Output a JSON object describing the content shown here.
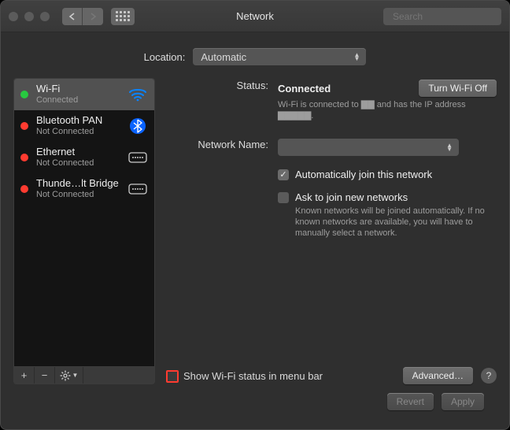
{
  "window": {
    "title": "Network"
  },
  "search": {
    "placeholder": "Search"
  },
  "location": {
    "label": "Location:",
    "value": "Automatic"
  },
  "services": [
    {
      "name": "Wi-Fi",
      "status": "Connected",
      "dot": "green",
      "icon": "wifi"
    },
    {
      "name": "Bluetooth PAN",
      "status": "Not Connected",
      "dot": "red",
      "icon": "bluetooth"
    },
    {
      "name": "Ethernet",
      "status": "Not Connected",
      "dot": "red",
      "icon": "ethernet"
    },
    {
      "name": "Thunde…lt Bridge",
      "status": "Not Connected",
      "dot": "red",
      "icon": "ethernet"
    }
  ],
  "detail": {
    "status_label": "Status:",
    "status_value": "Connected",
    "toggle_label": "Turn Wi-Fi Off",
    "status_sub": "Wi-Fi is connected to ▇▇ and has the IP address ▇▇▇▇▇.",
    "netname_label": "Network Name:",
    "netname_value": "",
    "auto_join": "Automatically join this network",
    "ask_join": "Ask to join new networks",
    "ask_sub": "Known networks will be joined automatically. If no known networks are available, you will have to manually select a network.",
    "show_status": "Show Wi-Fi status in menu bar",
    "advanced": "Advanced…"
  },
  "footer": {
    "revert": "Revert",
    "apply": "Apply"
  }
}
